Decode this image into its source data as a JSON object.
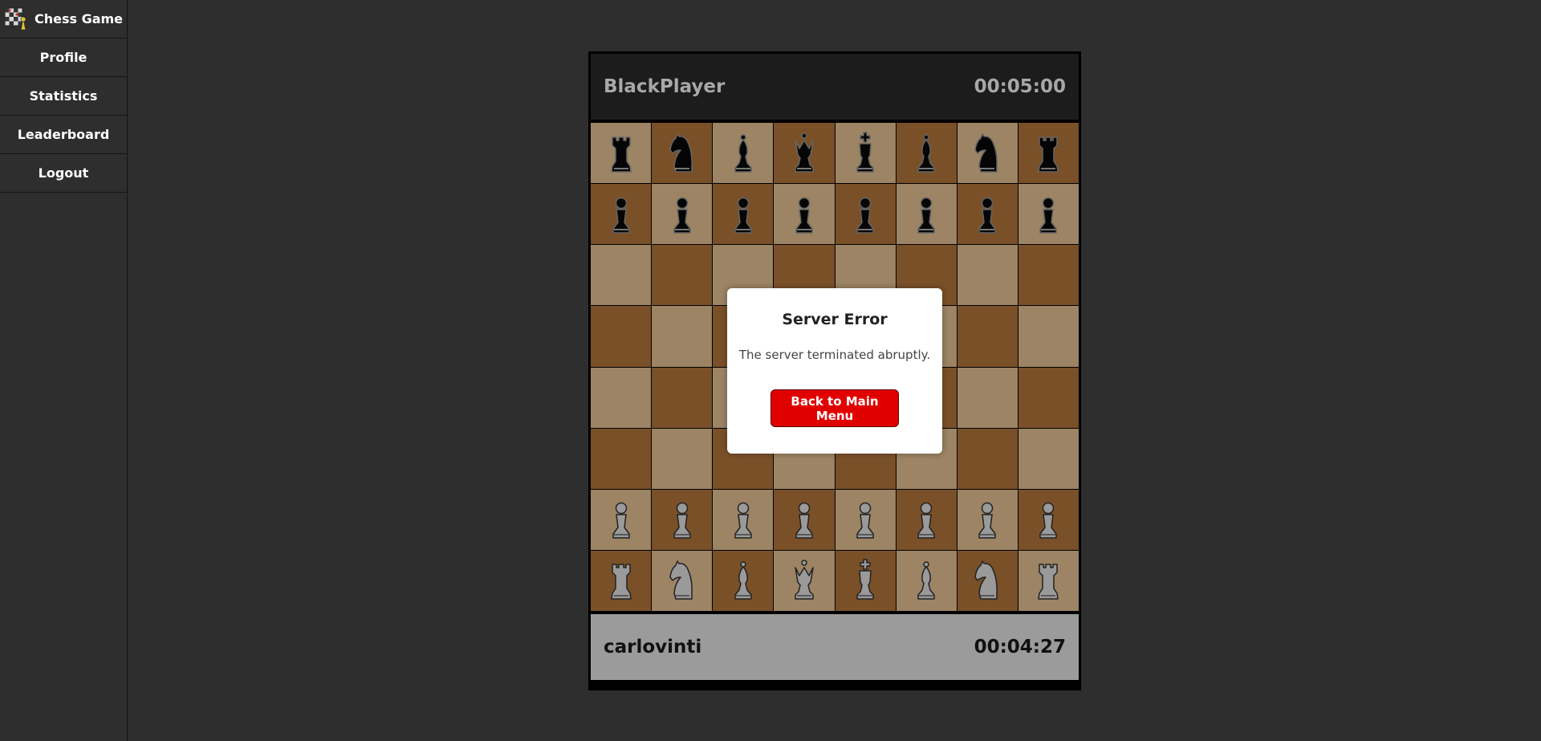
{
  "sidebar": {
    "brand_label": "Chess Game",
    "items": [
      {
        "label": "Profile"
      },
      {
        "label": "Statistics"
      },
      {
        "label": "Leaderboard"
      },
      {
        "label": "Logout"
      }
    ]
  },
  "game": {
    "top_player": {
      "name": "BlackPlayer",
      "clock": "00:05:00"
    },
    "bottom_player": {
      "name": "carlovinti",
      "clock": "00:04:27"
    },
    "board": [
      [
        "br",
        "bn",
        "bb",
        "bq",
        "bk",
        "bb",
        "bn",
        "br"
      ],
      [
        "bp",
        "bp",
        "bp",
        "bp",
        "bp",
        "bp",
        "bp",
        "bp"
      ],
      [
        "",
        "",
        "",
        "",
        "",
        "",
        "",
        ""
      ],
      [
        "",
        "",
        "",
        "",
        "",
        "",
        "",
        ""
      ],
      [
        "",
        "",
        "",
        "",
        "",
        "",
        "",
        ""
      ],
      [
        "",
        "",
        "",
        "",
        "",
        "",
        "",
        ""
      ],
      [
        "wp",
        "wp",
        "wp",
        "wp",
        "wp",
        "wp",
        "wp",
        "wp"
      ],
      [
        "wr",
        "wn",
        "wb",
        "wq",
        "wk",
        "wb",
        "wn",
        "wr"
      ]
    ],
    "colors": {
      "light_square": "#9c8464",
      "dark_square": "#7a5028",
      "black_piece": "#050505",
      "white_piece": "#9a9a9a"
    }
  },
  "modal": {
    "title": "Server Error",
    "message": "The server terminated abruptly.",
    "button_label": "Back to Main Menu",
    "button_color": "#e10000"
  }
}
